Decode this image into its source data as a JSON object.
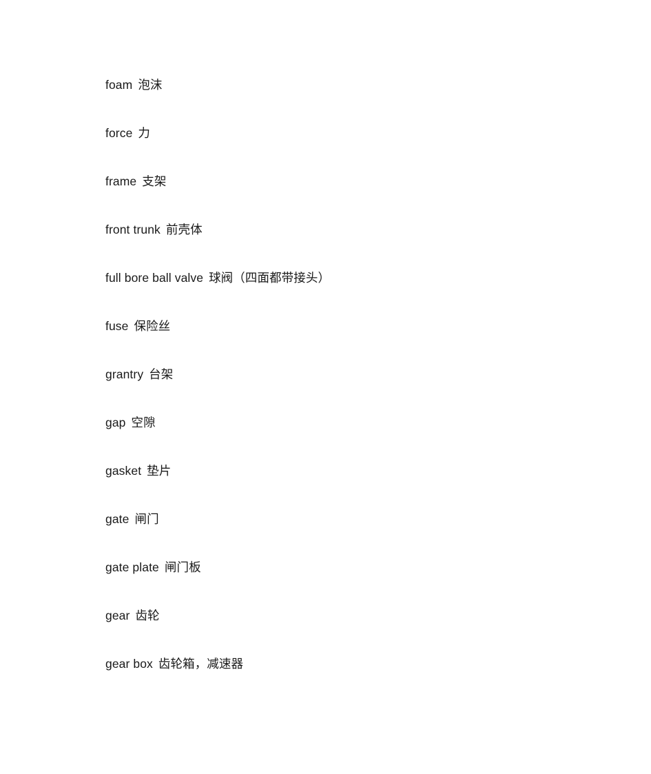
{
  "document": {
    "type": "bilingual-glossary",
    "background_color": "#ffffff",
    "text_color": "#1a1a1a",
    "entries": [
      {
        "term": "foam",
        "gloss": "泡沫"
      },
      {
        "term": "force",
        "gloss": "力"
      },
      {
        "term": "frame",
        "gloss": "支架"
      },
      {
        "term": "front trunk",
        "gloss": "前壳体"
      },
      {
        "term": "full bore ball valve",
        "gloss": "球阀（四面都带接头）"
      },
      {
        "term": "fuse",
        "gloss": "保险丝"
      },
      {
        "term": "grantry",
        "gloss": "台架"
      },
      {
        "term": "gap",
        "gloss": "空隙"
      },
      {
        "term": "gasket",
        "gloss": "垫片"
      },
      {
        "term": "gate",
        "gloss": "闸门"
      },
      {
        "term": "gate plate",
        "gloss": "闸门板"
      },
      {
        "term": "gear",
        "gloss": "齿轮"
      },
      {
        "term": "gear box",
        "gloss": "齿轮箱，减速器"
      }
    ]
  }
}
